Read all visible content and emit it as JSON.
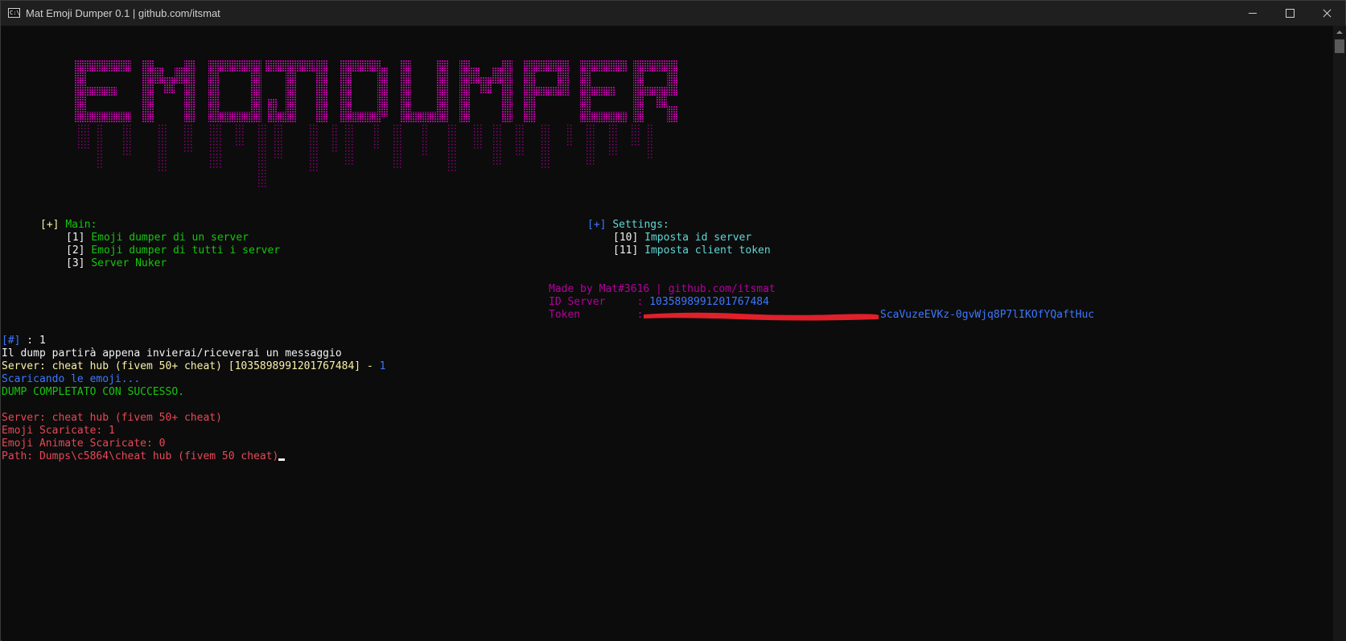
{
  "window": {
    "title": "Mat Emoji Dumper 0.1 | github.com/itsmat",
    "icon": "console-icon",
    "icon_text": "C:\\"
  },
  "banner": {
    "text": "EMOJI DUMPER",
    "color": "#b4009e"
  },
  "menu_main": {
    "bracket": "[+]",
    "title": "Main:",
    "items": [
      {
        "key": "[1]",
        "label": "Emoji dumper di un server"
      },
      {
        "key": "[2]",
        "label": "Emoji dumper di tutti i server"
      },
      {
        "key": "[3]",
        "label": "Server Nuker"
      }
    ]
  },
  "menu_settings": {
    "bracket": "[+]",
    "title": "Settings:",
    "items": [
      {
        "key": "[10]",
        "label": "Imposta id server"
      },
      {
        "key": "[11]",
        "label": "Imposta client token"
      }
    ]
  },
  "info": {
    "credits": "Made by Mat#3616 | github.com/itsmat",
    "id_label": "ID Server     : ",
    "id_value": "1035898991201767484",
    "token_label": "Token         :",
    "token_visible": "ScaVuzeEVKz-0gvWjq8P7lIKOfYQaftHuc"
  },
  "output": {
    "prompt_bracket": "[#]",
    "prompt_rest": " : 1",
    "line_dump_start": "Il dump partirà appena invierai/riceverai un messaggio",
    "line_server_prefix": "Server: cheat hub (fivem 50+ cheat) [1035898991201767484] - ",
    "line_server_count": "1",
    "line_downloading": "Scaricando le emoji...",
    "line_success": "DUMP COMPLETATO CON SUCCESSO.",
    "summary": [
      "Server: cheat hub (fivem 50+ cheat)",
      "Emoji Scaricate: 1",
      "Emoji Animate Scaricate: 0"
    ],
    "path": "Path: Dumps\\c5864\\cheat hub (fivem 50 cheat)"
  }
}
